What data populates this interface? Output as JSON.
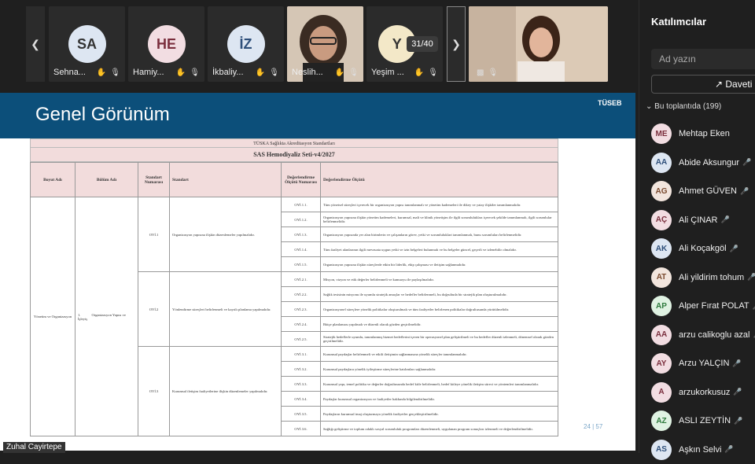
{
  "participant_strip": {
    "tiles": [
      {
        "initials": "SA",
        "name": "Sehna...",
        "color": "#dde6f2",
        "text_color": "#333"
      },
      {
        "initials": "HE",
        "name": "Hamiy...",
        "color": "#f2dde2",
        "text_color": "#7a2e3d"
      },
      {
        "initials": "İZ",
        "name": "İkbaliy...",
        "color": "#dde6f2",
        "text_color": "#2e4f7a"
      },
      {
        "initials": "",
        "name": "Neslih...",
        "color": "#b8a392",
        "text_color": "#333"
      },
      {
        "initials": "Y",
        "name": "Yeşim ...",
        "color": "#f3e8c8",
        "text_color": "#333"
      }
    ],
    "page_counter": "31/40",
    "prev_icon": "chevron-left-icon",
    "next_icon": "chevron-right-icon"
  },
  "slide": {
    "title": "Genel Görünüm",
    "logo_text": "TÜSEB",
    "doc_header1": "TÜSKA Sağlıkta Akreditasyon Standartları",
    "doc_header2": "SAS Hemodiyaliz  Seti-v4/2027",
    "table_headers": [
      "Boyut Adı",
      "Bölüm Adı",
      "Standart Numarası",
      "Standart",
      "Değerlendirme Ölçütü Numarası",
      "Değerlendirme Ölçütü"
    ],
    "boyut": "Yönetim ve Organizasyon",
    "bolum_no": "1.",
    "bolum": "Organizasyon Yapısı ve İşleyiş",
    "groups": [
      {
        "no": "OYİ.1",
        "standard": "Organizasyon yapısına ilişkin düzenlemeler yapılmalıdır.",
        "criteria": [
          {
            "no": "OYİ.1.1.",
            "text": "Tüm yönetsel süreçleri içerecek bir organizasyon yapısı tanımlanmalı ve yönetim kademeleri ile dikey ve yatay ilişkiler tanımlanmalıdır."
          },
          {
            "no": "OYİ.1.2.",
            "text": "Organizasyon yapısına ilişkin yönetim kademeleri, kurumsal, mali ve klinik yönetişim ile ilgili sorumlulukları içerecek şekilde tanımlanmalı, ilgili sorumlular belirlenmelidir."
          },
          {
            "no": "OYİ.1.3.",
            "text": "Organizasyon yapısında yer alan birimlerin ve çalışanların görev, yetki ve sorumluluklari tanımlanmalı, bunu sorumluları belirlenmelidir."
          },
          {
            "no": "OYİ.1.4.",
            "text": "Tüm faaliyet alanlarının ilgili mevzuata uygun yetki ve izin belgeleri bulunmalı ve bu belgeler güncel, geçerli ve izlenebilir olmalıdır."
          },
          {
            "no": "OYİ.1.5.",
            "text": "Organizasyon yapısına ilişkin süreçlerde etkin bir liderlik, ekip çalışması ve iletişim sağlanmalıdır."
          }
        ]
      },
      {
        "no": "OYİ.2",
        "standard": "Yönlendirme süreçleri belirlenmeli ve kayıtlı planlama yapılmalıdır.",
        "criteria": [
          {
            "no": "OYİ.2.1.",
            "text": "Misyon, vizyon ve etik değerler belirlenmeli ve kamuoyu ile paylaşılmalıdır."
          },
          {
            "no": "OYİ.2.2.",
            "text": "Sağlık tesisinin misyonu ile uyumlu stratejik amaçlar ve hedefler belirlenmeli, bu doğrultuda bir stratejik plan oluşturulmalıdır."
          },
          {
            "no": "OYİ.2.3.",
            "text": "Organizasyonel süreçlere yönelik politikalar oluşturulmalı ve tüm faaliyetler belirlenen politikalar doğrultusunda yürütülmelidir."
          },
          {
            "no": "OYİ.2.4.",
            "text": "Bütçe planlaması yapılmalı ve düzenli olarak gözden geçirilmelidir."
          },
          {
            "no": "OYİ.2.5.",
            "text": "Stratejik hedeflerle uyumlu, tanımlanmış hizmet hedeflerini içeren bir operasyonel plan geliştirilmeli ve bu hedefler düzenli izlenmeli, dönemsel olarak gözden geçirilmelidir."
          }
        ]
      },
      {
        "no": "OYİ.3",
        "standard": "Kurumsal iletişim faaliyetlerine ilişkin düzenlemeler yapılmalıdır.",
        "criteria": [
          {
            "no": "OYİ.3.1.",
            "text": "Kurumsal paydaşlar belirlenmeli ve etkili iletişimin sağlanmasına yönelik süreçler tanımlanmalıdır."
          },
          {
            "no": "OYİ.3.2.",
            "text": "Kurumsal paydaşlara yönelik iyileştirme süreçlerine katılımları sağlanmalıdır."
          },
          {
            "no": "OYİ.3.3.",
            "text": "Kurumsal yapı, temel politika ve değerler doğrultusunda hedef kitle belirlenmeli, hedef kitleye yönelik iletişim süreci ve yöntemleri tanımlanmalıdır."
          },
          {
            "no": "OYİ.3.4.",
            "text": "Paydaşlar kurumsal organizasyon ve faaliyetler hakkında bilgilendirilmelidir."
          },
          {
            "no": "OYİ.3.5.",
            "text": "Paydaşların kurumsal imaj oluşturmaya yönelik faaliyetler gerçekleştirilmelidir."
          },
          {
            "no": "OYİ.3.6.",
            "text": "Sağlığı geliştirme ve toplum odaklı sosyal sorumluluk programları düzenlenmeli, uygulanan program sonuçları izlenmeli ve değerlendirilmelidir."
          }
        ]
      }
    ],
    "page_number": "24 | 57"
  },
  "sidebar": {
    "title": "Katılımcılar",
    "search_placeholder": "Ad yazın",
    "invite_label": "Daveti",
    "section_label": "Bu toplantıda (199)",
    "participants": [
      {
        "initials": "ME",
        "name": "Mehtap Eken",
        "mic": false,
        "color": "#f2dde2",
        "tc": "#7a2e3d"
      },
      {
        "initials": "AA",
        "name": "Abide Aksungur",
        "mic": true,
        "color": "#dde6f2",
        "tc": "#2e4f7a"
      },
      {
        "initials": "AG",
        "name": "Ahmet GÜVEN",
        "mic": true,
        "color": "#f2e5dd",
        "tc": "#7a4a2e"
      },
      {
        "initials": "AÇ",
        "name": "Ali ÇINAR",
        "mic": true,
        "color": "#f2dde2",
        "tc": "#7a2e3d"
      },
      {
        "initials": "AK",
        "name": "Ali Koçakgöl",
        "mic": true,
        "color": "#dde6f2",
        "tc": "#2e4f7a"
      },
      {
        "initials": "AT",
        "name": "Ali yildirim tohum",
        "mic": true,
        "color": "#f2e5dd",
        "tc": "#7a4a2e"
      },
      {
        "initials": "AP",
        "name": "Alper Fırat POLAT",
        "mic": true,
        "color": "#dff2e2",
        "tc": "#2e7a3d"
      },
      {
        "initials": "AA",
        "name": "arzu calikoglu azal",
        "mic": true,
        "color": "#f2dde2",
        "tc": "#7a2e3d"
      },
      {
        "initials": "AY",
        "name": "Arzu YALÇIN",
        "mic": true,
        "color": "#f2dde2",
        "tc": "#7a2e3d"
      },
      {
        "initials": "A",
        "name": "arzukorkusuz",
        "mic": true,
        "color": "#f2dde2",
        "tc": "#7a2e3d"
      },
      {
        "initials": "AZ",
        "name": "ASLI ZEYTİN",
        "mic": true,
        "color": "#dff2e2",
        "tc": "#2e7a3d"
      },
      {
        "initials": "AS",
        "name": "Aşkın Selvi",
        "mic": true,
        "color": "#dde6f2",
        "tc": "#2e4f7a"
      }
    ]
  },
  "presenter_label": "Zuhal Cayirtepe"
}
